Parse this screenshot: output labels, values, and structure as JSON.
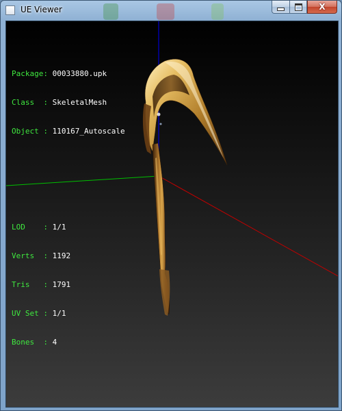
{
  "window": {
    "title": "UE Viewer",
    "icon": "app-window-icon",
    "controls": {
      "minimize_icon": "minimize-icon",
      "maximize_icon": "maximize-icon",
      "close_label": "X"
    }
  },
  "info": {
    "group1": [
      {
        "key": "Package",
        "sep": ": ",
        "value": "00033880.upk"
      },
      {
        "key": "Class  ",
        "sep": ": ",
        "value": "SkeletalMesh"
      },
      {
        "key": "Object ",
        "sep": ": ",
        "value": "110167_Autoscale"
      }
    ],
    "group2": [
      {
        "key": "LOD    ",
        "sep": ": ",
        "value": "1/1"
      },
      {
        "key": "Verts  ",
        "sep": ": ",
        "value": "1192"
      },
      {
        "key": "Tris   ",
        "sep": ": ",
        "value": "1791"
      },
      {
        "key": "UV Set ",
        "sep": ": ",
        "value": "1/1"
      },
      {
        "key": "Bones  ",
        "sep": ": ",
        "value": "4"
      }
    ]
  },
  "colors": {
    "hud_key": "#3fe83f",
    "hud_value": "#ffffff",
    "axis_x": "#c00000",
    "axis_y": "#00c000",
    "axis_z": "#0000d0",
    "mesh_gold": "#c89a3a",
    "mesh_dark": "#5a3510"
  }
}
